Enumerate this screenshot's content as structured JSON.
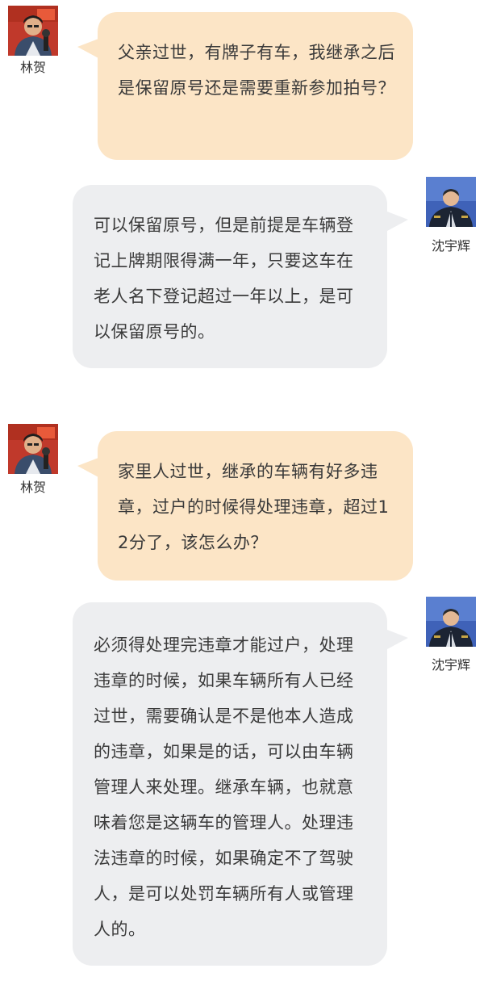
{
  "conversation": [
    {
      "speaker": "林贺",
      "side": "left",
      "avatar_icon": "host-avatar-icon",
      "text": "父亲过世，有牌子有车，我继承之后是保留原号还是需要重新参加拍号？"
    },
    {
      "speaker": "沈宇辉",
      "side": "right",
      "avatar_icon": "police-officer-avatar-icon",
      "text": "可以保留原号，但是前提是车辆登记上牌期限得满一年，只要这车在老人名下登记超过一年以上，是可以保留原号的。"
    },
    {
      "speaker": "林贺",
      "side": "left",
      "avatar_icon": "host-avatar-icon",
      "text": "家里人过世，继承的车辆有好多违章，过户的时候得处理违章，超过12分了，该怎么办？"
    },
    {
      "speaker": "沈宇辉",
      "side": "right",
      "avatar_icon": "police-officer-avatar-icon",
      "text": "必须得处理完违章才能过户，处理违章的时候，如果车辆所有人已经过世，需要确认是不是他本人造成的违章，如果是的话，可以由车辆管理人来处理。继承车辆，也就意味着您是这辆车的管理人。处理违法违章的时候，如果确定不了驾驶人，是可以处罚车辆所有人或管理人的。"
    }
  ],
  "colors": {
    "left_bubble": "#fce5c6",
    "right_bubble": "#edeef0",
    "text": "#3a3a3a"
  }
}
